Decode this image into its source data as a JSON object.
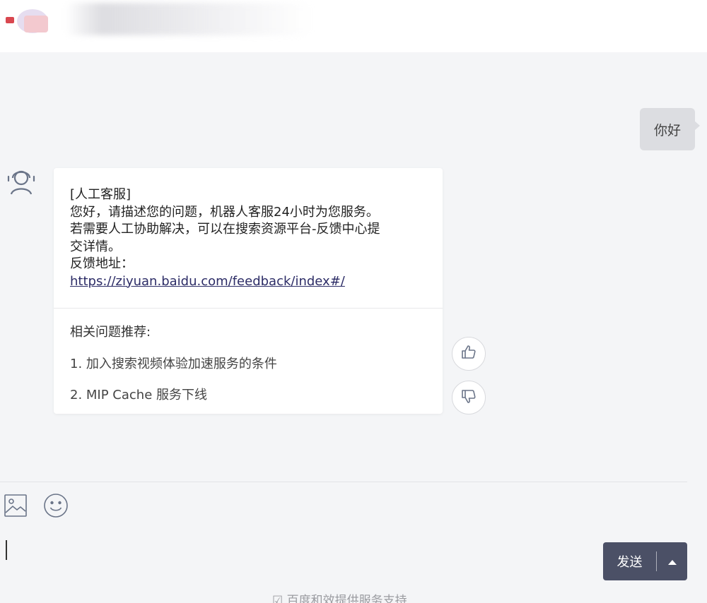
{
  "header": {
    "logo_icon": "app-logo-icon"
  },
  "conversation": {
    "user_message": "你好",
    "bot": {
      "avatar_icon": "headset-agent-icon",
      "tag": "[人工客服]",
      "lines": [
        "您好，请描述您的问题，机器人客服24小时为您服务。",
        "若需要人工协助解决，可以在搜索资源平台-反馈中心提",
        "交详情。",
        "反馈地址："
      ],
      "link": "https://ziyuan.baidu.com/feedback/index#/",
      "related_title": "相关问题推荐:",
      "related": [
        "1. 加入搜索视频体验加速服务的条件",
        "2. MIP Cache 服务下线"
      ]
    },
    "feedback": {
      "like_icon": "thumbs-up-icon",
      "dislike_icon": "thumbs-down-icon"
    }
  },
  "composer": {
    "image_icon": "image-upload-icon",
    "emoji_icon": "emoji-icon",
    "send_label": "发送",
    "menu_icon": "caret-up-icon"
  },
  "footer": {
    "note": "☑ 百度和效提供服务支持"
  },
  "colors": {
    "background": "#f4f5f7",
    "send_button": "#4b5066",
    "user_bubble": "#dcdde1",
    "link": "#2c2c66"
  }
}
